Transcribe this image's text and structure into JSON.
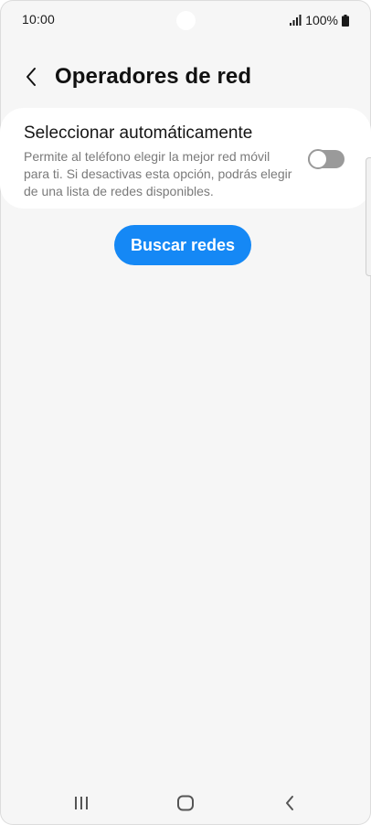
{
  "status_bar": {
    "time": "10:00",
    "battery": "100%",
    "icons": [
      "signal-icon",
      "battery-icon"
    ]
  },
  "header": {
    "title": "Operadores de red",
    "back_icon": "chevron-left-icon"
  },
  "auto_select": {
    "title": "Seleccionar automáticamente",
    "description": "Permite al teléfono elegir la mejor red móvil para ti. Si desactivas esta opción, podrás elegir de una lista de redes disponibles.",
    "enabled": false
  },
  "search_button": {
    "label": "Buscar redes"
  },
  "nav_bar": {
    "icons": [
      "recents-icon",
      "home-icon",
      "back-icon"
    ]
  },
  "colors": {
    "accent": "#1588f5",
    "background": "#f6f6f6",
    "card": "#ffffff",
    "toggle_off": "#9a9a9a"
  }
}
